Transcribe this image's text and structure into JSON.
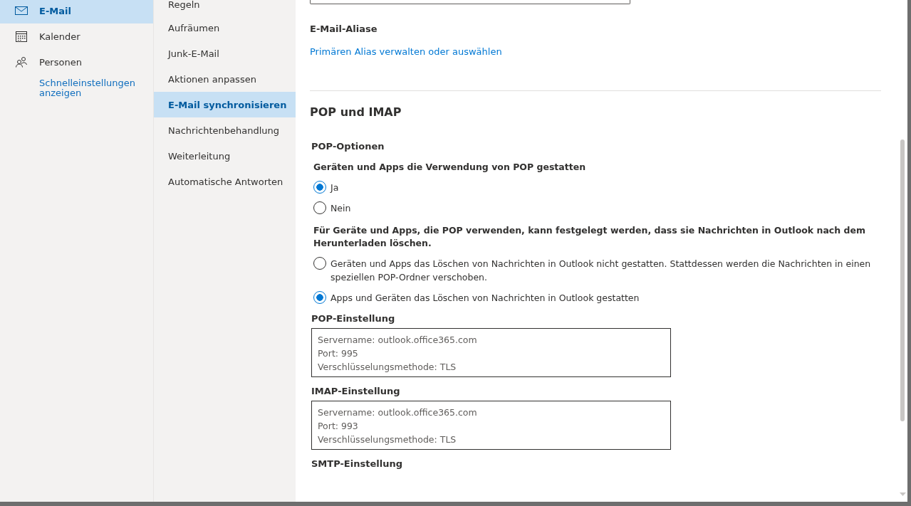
{
  "nav": [
    {
      "label": "E-Mail",
      "selected": true
    },
    {
      "label": "Kalender",
      "selected": false
    },
    {
      "label": "Personen",
      "selected": false
    }
  ],
  "quick_settings_link": "Schnelleinstellungen anzeigen",
  "submenu": [
    {
      "label": "Regeln",
      "selected": false
    },
    {
      "label": "Aufräumen",
      "selected": false
    },
    {
      "label": "Junk-E-Mail",
      "selected": false
    },
    {
      "label": "Aktionen anpassen",
      "selected": false
    },
    {
      "label": "E-Mail synchronisieren",
      "selected": true
    },
    {
      "label": "Nachrichtenbehandlung",
      "selected": false
    },
    {
      "label": "Weiterleitung",
      "selected": false
    },
    {
      "label": "Automatische Antworten",
      "selected": false
    }
  ],
  "aliases": {
    "heading": "E-Mail-Aliase",
    "link": "Primären Alias verwalten oder auswählen"
  },
  "pop_imap": {
    "heading": "POP und IMAP",
    "pop_options": "POP-Optionen",
    "groups": [
      {
        "question": "Geräten und Apps die Verwendung von POP gestatten",
        "options": [
          {
            "label": "Ja",
            "selected": true
          },
          {
            "label": "Nein",
            "selected": false
          }
        ]
      },
      {
        "question": "Für Geräte und Apps, die POP verwenden, kann festgelegt werden, dass sie Nachrichten in Outlook nach dem Herunterladen löschen.",
        "options": [
          {
            "label": "Geräten und Apps das Löschen von Nachrichten in Outlook nicht gestatten. Stattdessen werden die Nachrichten in einen speziellen POP-Ordner verschoben.",
            "selected": false
          },
          {
            "label": "Apps und Geräten das Löschen von Nachrichten in Outlook gestatten",
            "selected": true
          }
        ]
      }
    ],
    "settings": [
      {
        "title": "POP-Einstellung",
        "lines": [
          "Servername: outlook.office365.com",
          "Port: 995",
          "Verschlüsselungsmethode: TLS"
        ]
      },
      {
        "title": "IMAP-Einstellung",
        "lines": [
          "Servername: outlook.office365.com",
          "Port: 993",
          "Verschlüsselungsmethode: TLS"
        ]
      },
      {
        "title": "SMTP-Einstellung"
      }
    ]
  }
}
